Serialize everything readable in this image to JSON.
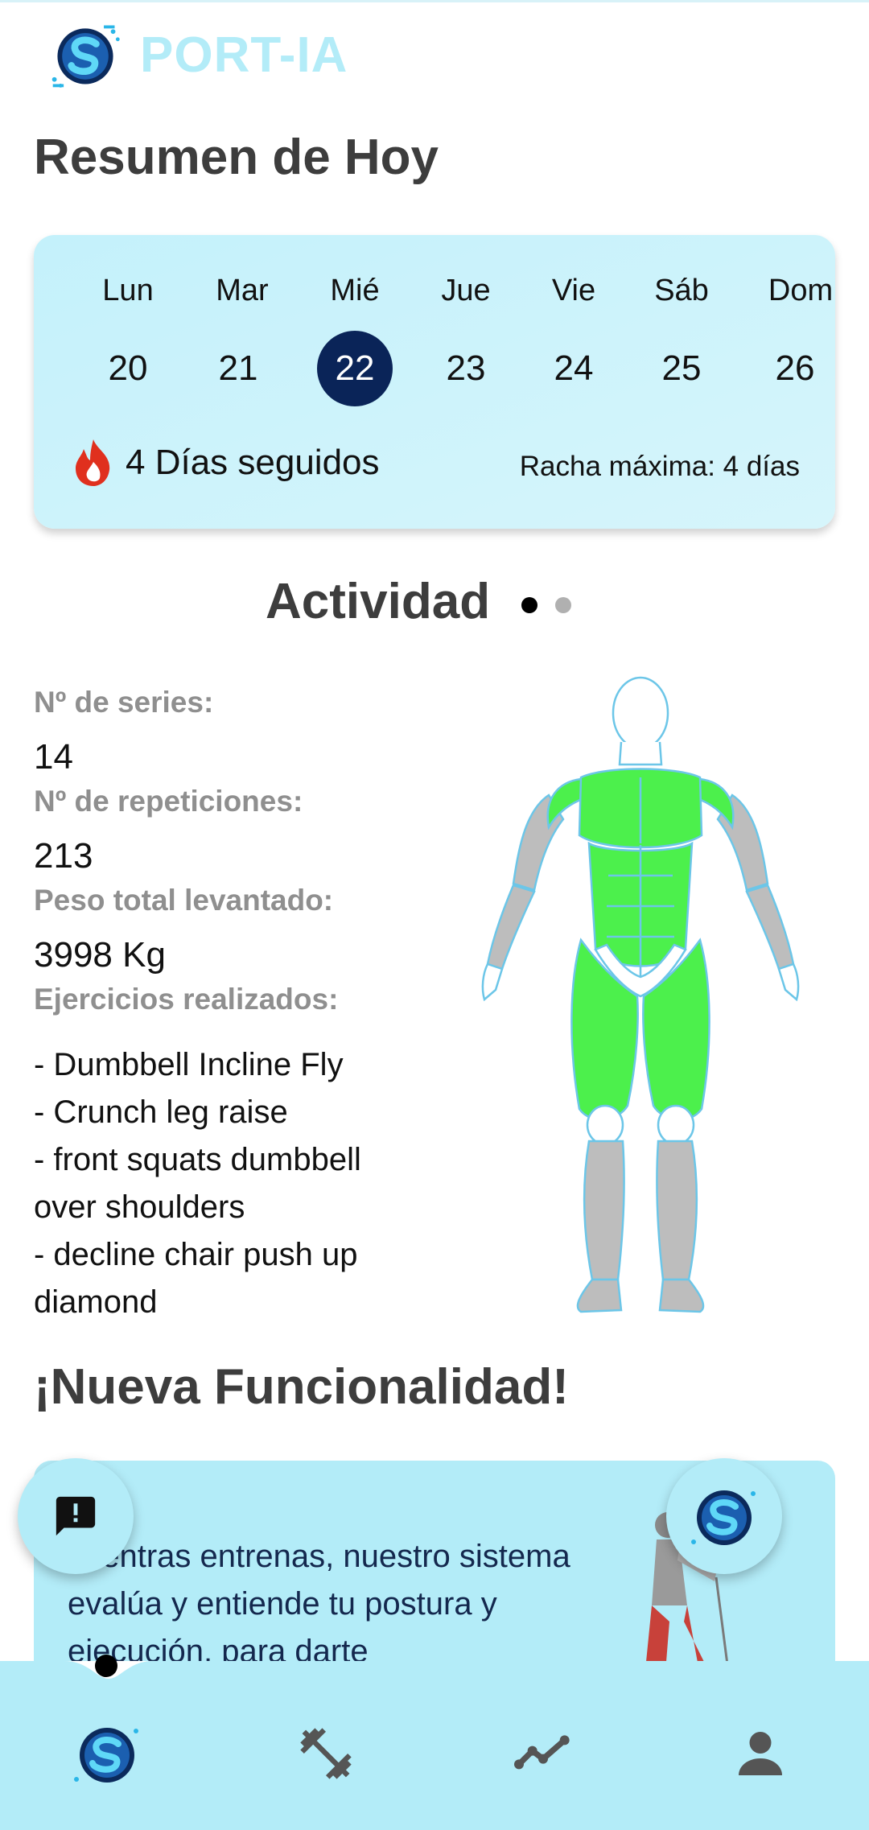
{
  "app": {
    "brand": "PORT-IA"
  },
  "header": {
    "title": "Resumen de Hoy"
  },
  "week": {
    "days": [
      {
        "name": "Lun",
        "num": "20"
      },
      {
        "name": "Mar",
        "num": "21"
      },
      {
        "name": "Mié",
        "num": "22"
      },
      {
        "name": "Jue",
        "num": "23"
      },
      {
        "name": "Vie",
        "num": "24"
      },
      {
        "name": "Sáb",
        "num": "25"
      },
      {
        "name": "Dom",
        "num": "26"
      }
    ],
    "selected_day": "22",
    "streak": "4 Días seguidos",
    "max_streak": "Racha máxima: 4 días"
  },
  "activity": {
    "title": "Actividad",
    "page_count": 2,
    "current_page": 1,
    "series_label": "Nº de series:",
    "series_value": "14",
    "reps_label": "Nº de repeticiones:",
    "reps_value": "213",
    "weight_label": "Peso total levantado:",
    "weight_value": "3998  Kg",
    "exercises_label": "Ejercicios realizados:",
    "exercises": [
      "- Dumbbell Incline Fly",
      "- Crunch leg raise",
      "- front squats dumbbell over shoulders",
      "- decline chair push up diamond"
    ],
    "muscle_colors": {
      "worked": "#4cf04c",
      "rest": "#bdbdbd",
      "outline": "#6cc6e8"
    }
  },
  "new_feature": {
    "title": "¡Nueva Funcionalidad!",
    "text": "Mientras entrenas, nuestro sistema evalúa y entiende tu postura y ejecución, para darte"
  },
  "fabs": {
    "left_icon": "feedback-icon",
    "right_icon": "app-logo-icon"
  },
  "nav": {
    "items": [
      "home-logo-icon",
      "dumbbell-icon",
      "progress-chart-icon",
      "profile-icon"
    ],
    "active": 0
  },
  "colors": {
    "accent": "#b3ecf8",
    "selected_day": "#0a2458",
    "flame": "#e0301e"
  }
}
